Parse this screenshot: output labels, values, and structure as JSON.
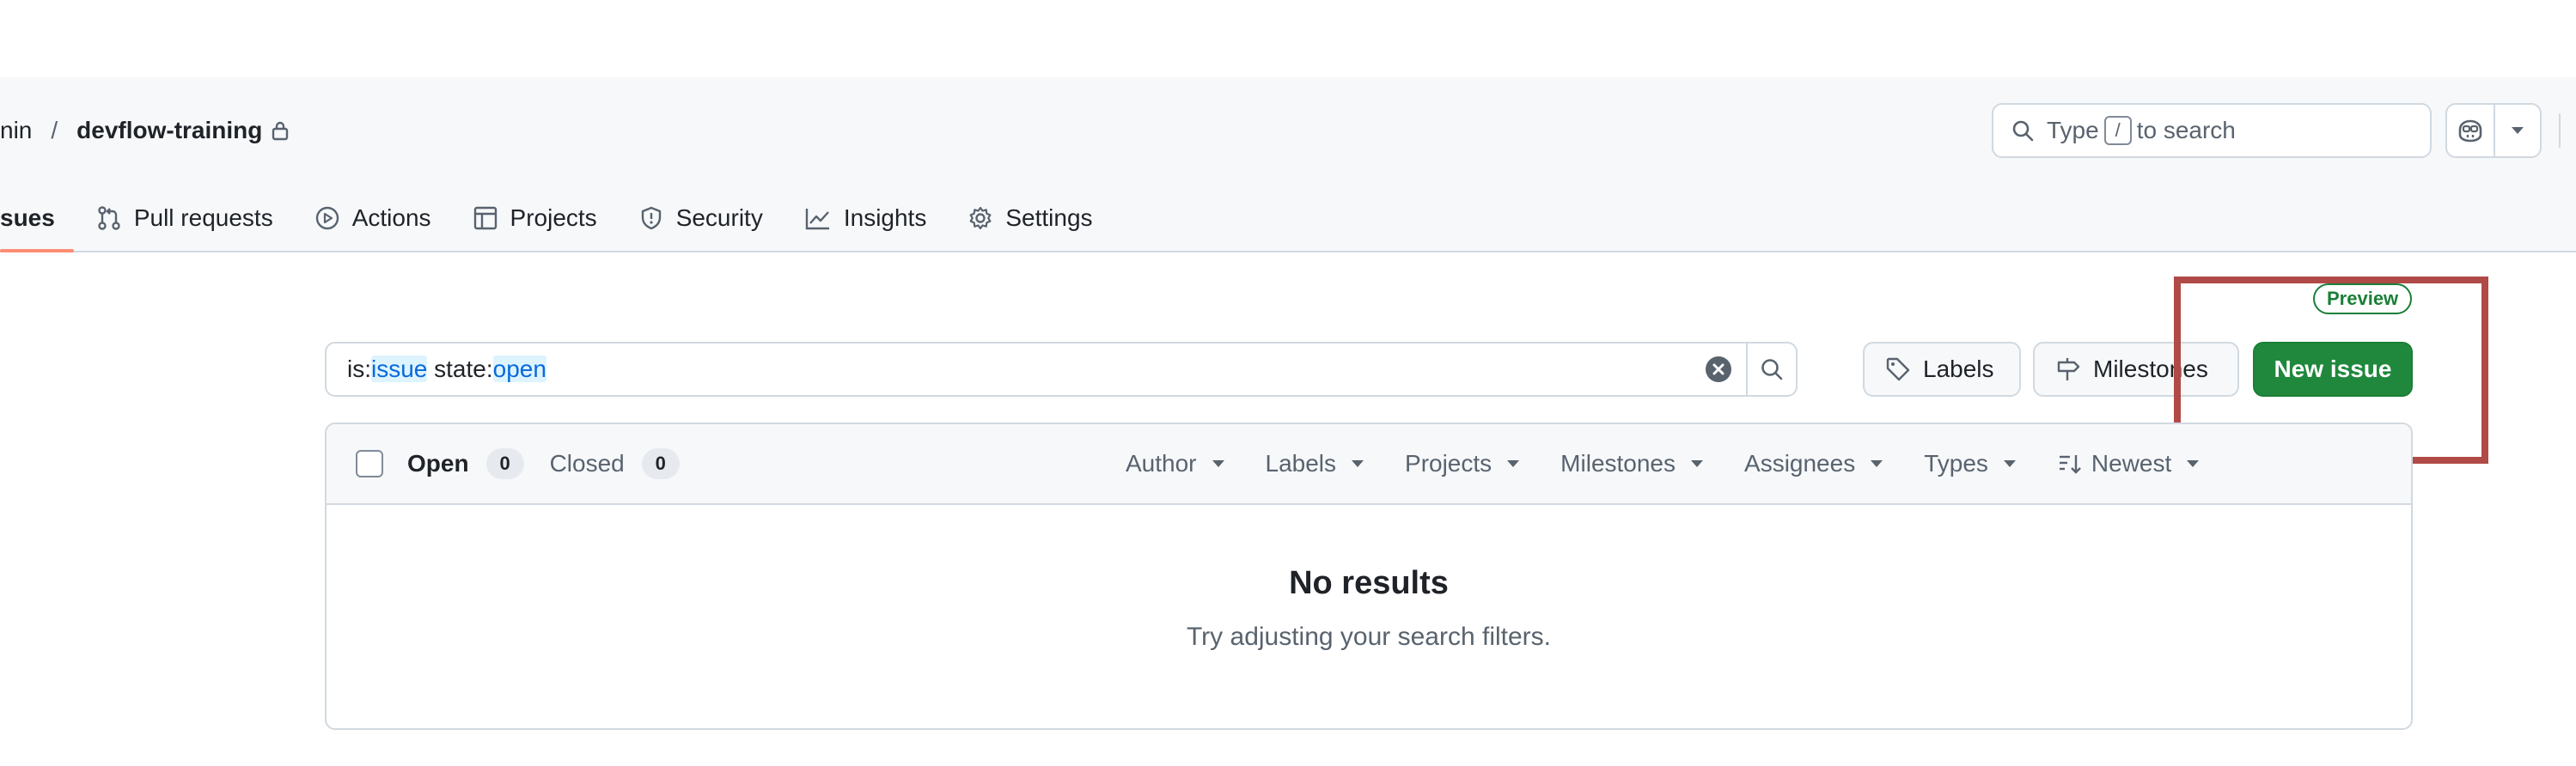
{
  "breadcrumb": {
    "owner": "nin",
    "separator": "/",
    "repo": "devflow-training"
  },
  "top_search": {
    "prefix": "Type",
    "key": "/",
    "suffix": "to search"
  },
  "tabs": [
    {
      "label": "sues",
      "icon": "issues-icon",
      "active": true
    },
    {
      "label": "Pull requests",
      "icon": "git-pull-request-icon"
    },
    {
      "label": "Actions",
      "icon": "play-circle-icon"
    },
    {
      "label": "Projects",
      "icon": "table-icon"
    },
    {
      "label": "Security",
      "icon": "shield-icon"
    },
    {
      "label": "Insights",
      "icon": "graph-icon"
    },
    {
      "label": "Settings",
      "icon": "gear-icon"
    }
  ],
  "preview_badge": "Preview",
  "filter": {
    "prefix1": "is:",
    "value1": "issue",
    "prefix2": " state:",
    "value2": "open"
  },
  "buttons": {
    "labels": "Labels",
    "milestones": "Milestones",
    "new_issue": "New issue"
  },
  "list_header": {
    "open_label": "Open",
    "open_count": "0",
    "closed_label": "Closed",
    "closed_count": "0",
    "facets": [
      "Author",
      "Labels",
      "Projects",
      "Milestones",
      "Assignees",
      "Types",
      "Newest"
    ]
  },
  "empty_state": {
    "title": "No results",
    "message": "Try adjusting your search filters."
  },
  "colors": {
    "primary_button": "#1f883d",
    "accent_underline": "#fd8c73",
    "highlight_box": "#b04a46",
    "link_blue": "#0969da"
  }
}
